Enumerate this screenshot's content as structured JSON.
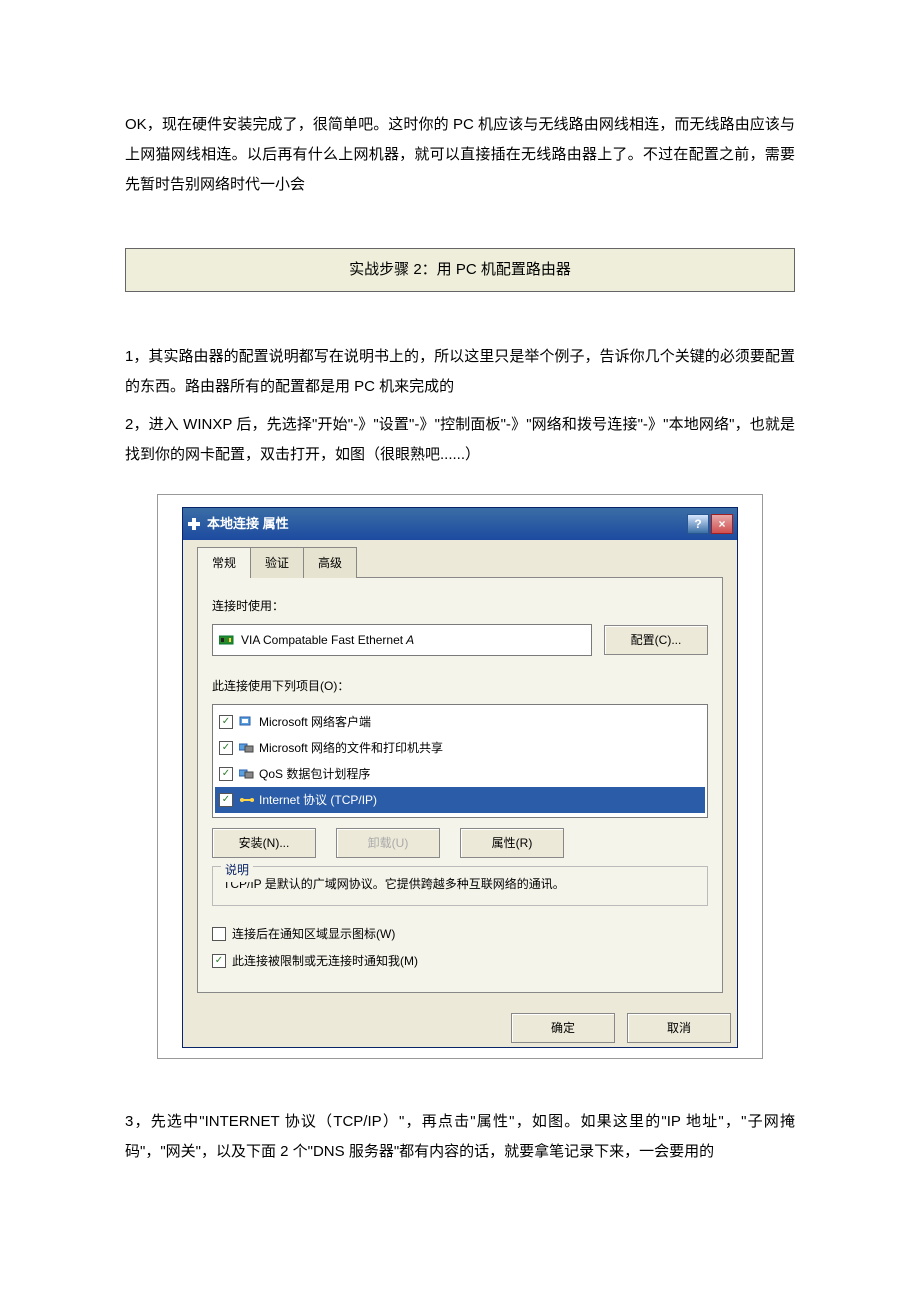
{
  "intro_para": "OK，现在硬件安装完成了，很简单吧。这时你的 PC 机应该与无线路由网线相连，而无线路由应该与上网猫网线相连。以后再有什么上网机器，就可以直接插在无线路由器上了。不过在配置之前，需要先暂时告别网络时代一小会",
  "step_box": "实战步骤 2：用 PC 机配置路由器",
  "para1": "1，其实路由器的配置说明都写在说明书上的，所以这里只是举个例子，告诉你几个关键的必须要配置的东西。路由器所有的配置都是用 PC 机来完成的",
  "para2": "2，进入 WINXP 后，先选择\"开始\"-》\"设置\"-》\"控制面板\"-》\"网络和拨号连接\"-》\"本地网络\"，也就是找到你的网卡配置，双击打开，如图（很眼熟吧......）",
  "dialog": {
    "title": "本地连接 属性",
    "tabs": {
      "general": "常规",
      "auth": "验证",
      "advanced": "高级"
    },
    "connect_using": "连接时使用：",
    "adapter_name": "VIA Compatable Fast Ethernet",
    "adapter_suffix": "A",
    "configure_btn": "配置(C)...",
    "items_label": "此连接使用下列项目(O)：",
    "items": [
      "Microsoft 网络客户端",
      "Microsoft 网络的文件和打印机共享",
      "QoS 数据包计划程序",
      "Internet 协议 (TCP/IP)"
    ],
    "install_btn": "安装(N)...",
    "uninstall_btn": "卸载(U)",
    "properties_btn": "属性(R)",
    "desc_legend": "说明",
    "desc_text": "TCP/IP 是默认的广域网协议。它提供跨越多种互联网络的通讯。",
    "show_icon": "连接后在通知区域显示图标(W)",
    "notify_limited": "此连接被限制或无连接时通知我(M)",
    "ok": "确定",
    "cancel": "取消"
  },
  "para3": "3，先选中\"INTERNET 协议（TCP/IP）\"，再点击\"属性\"，如图。如果这里的\"IP 地址\"，\"子网掩码\"，\"网关\"，以及下面 2 个\"DNS 服务器\"都有内容的话，就要拿笔记录下来，一会要用的"
}
